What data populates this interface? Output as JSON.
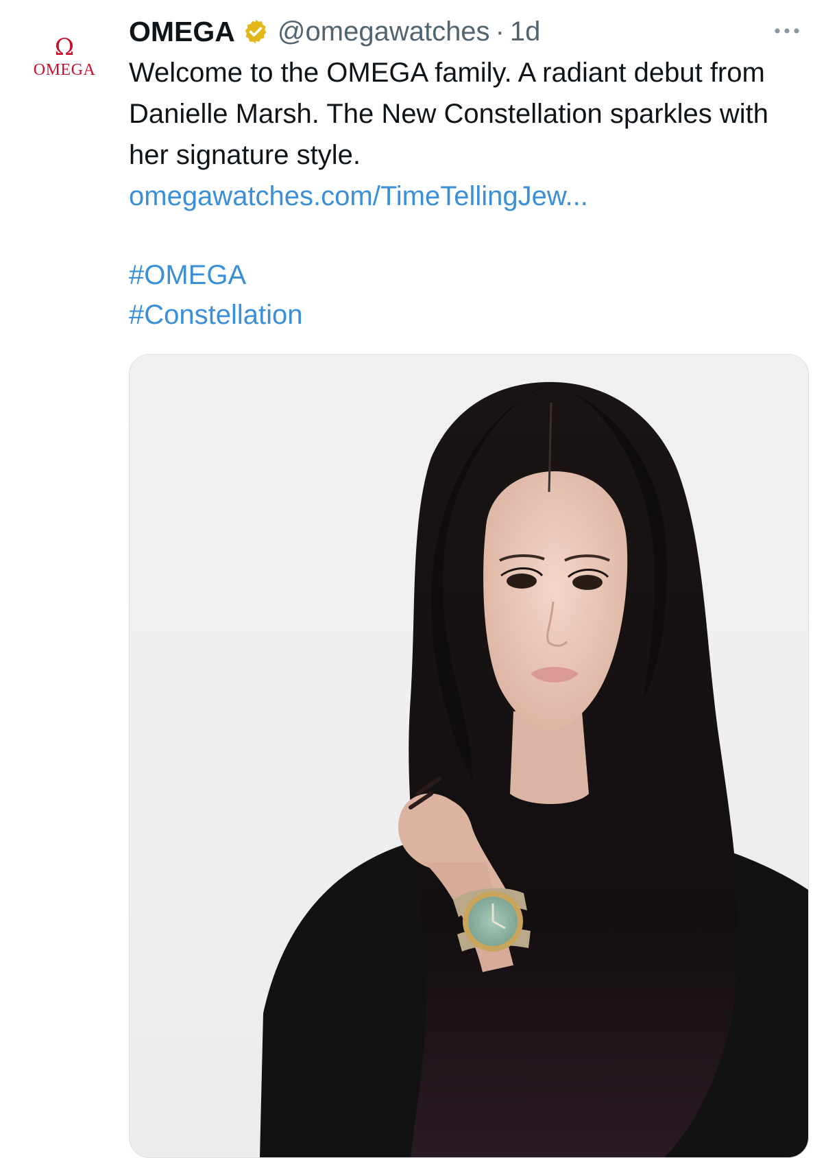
{
  "account": {
    "logo_symbol": "Ω",
    "logo_word": "OMEGA",
    "display_name": "OMEGA",
    "verified_icon": "verified-badge-gold",
    "handle": "@omegawatches",
    "separator": "·",
    "time": "1d"
  },
  "actions": {
    "more_icon": "more-horizontal-icon"
  },
  "tweet": {
    "text": "Welcome to the OMEGA family. A radiant debut from Danielle Marsh. The New Constellation sparkles with her signature style.",
    "link": "omegawatches.com/TimeTellingJew...",
    "hashtags": [
      "#OMEGA",
      "#Constellation"
    ]
  },
  "media": {
    "background_color": "#efefef"
  },
  "colors": {
    "brand_red": "#c8102e",
    "link_blue": "#3a8fd6",
    "muted_gray": "#536471",
    "badge_gold": "#e2b719"
  }
}
